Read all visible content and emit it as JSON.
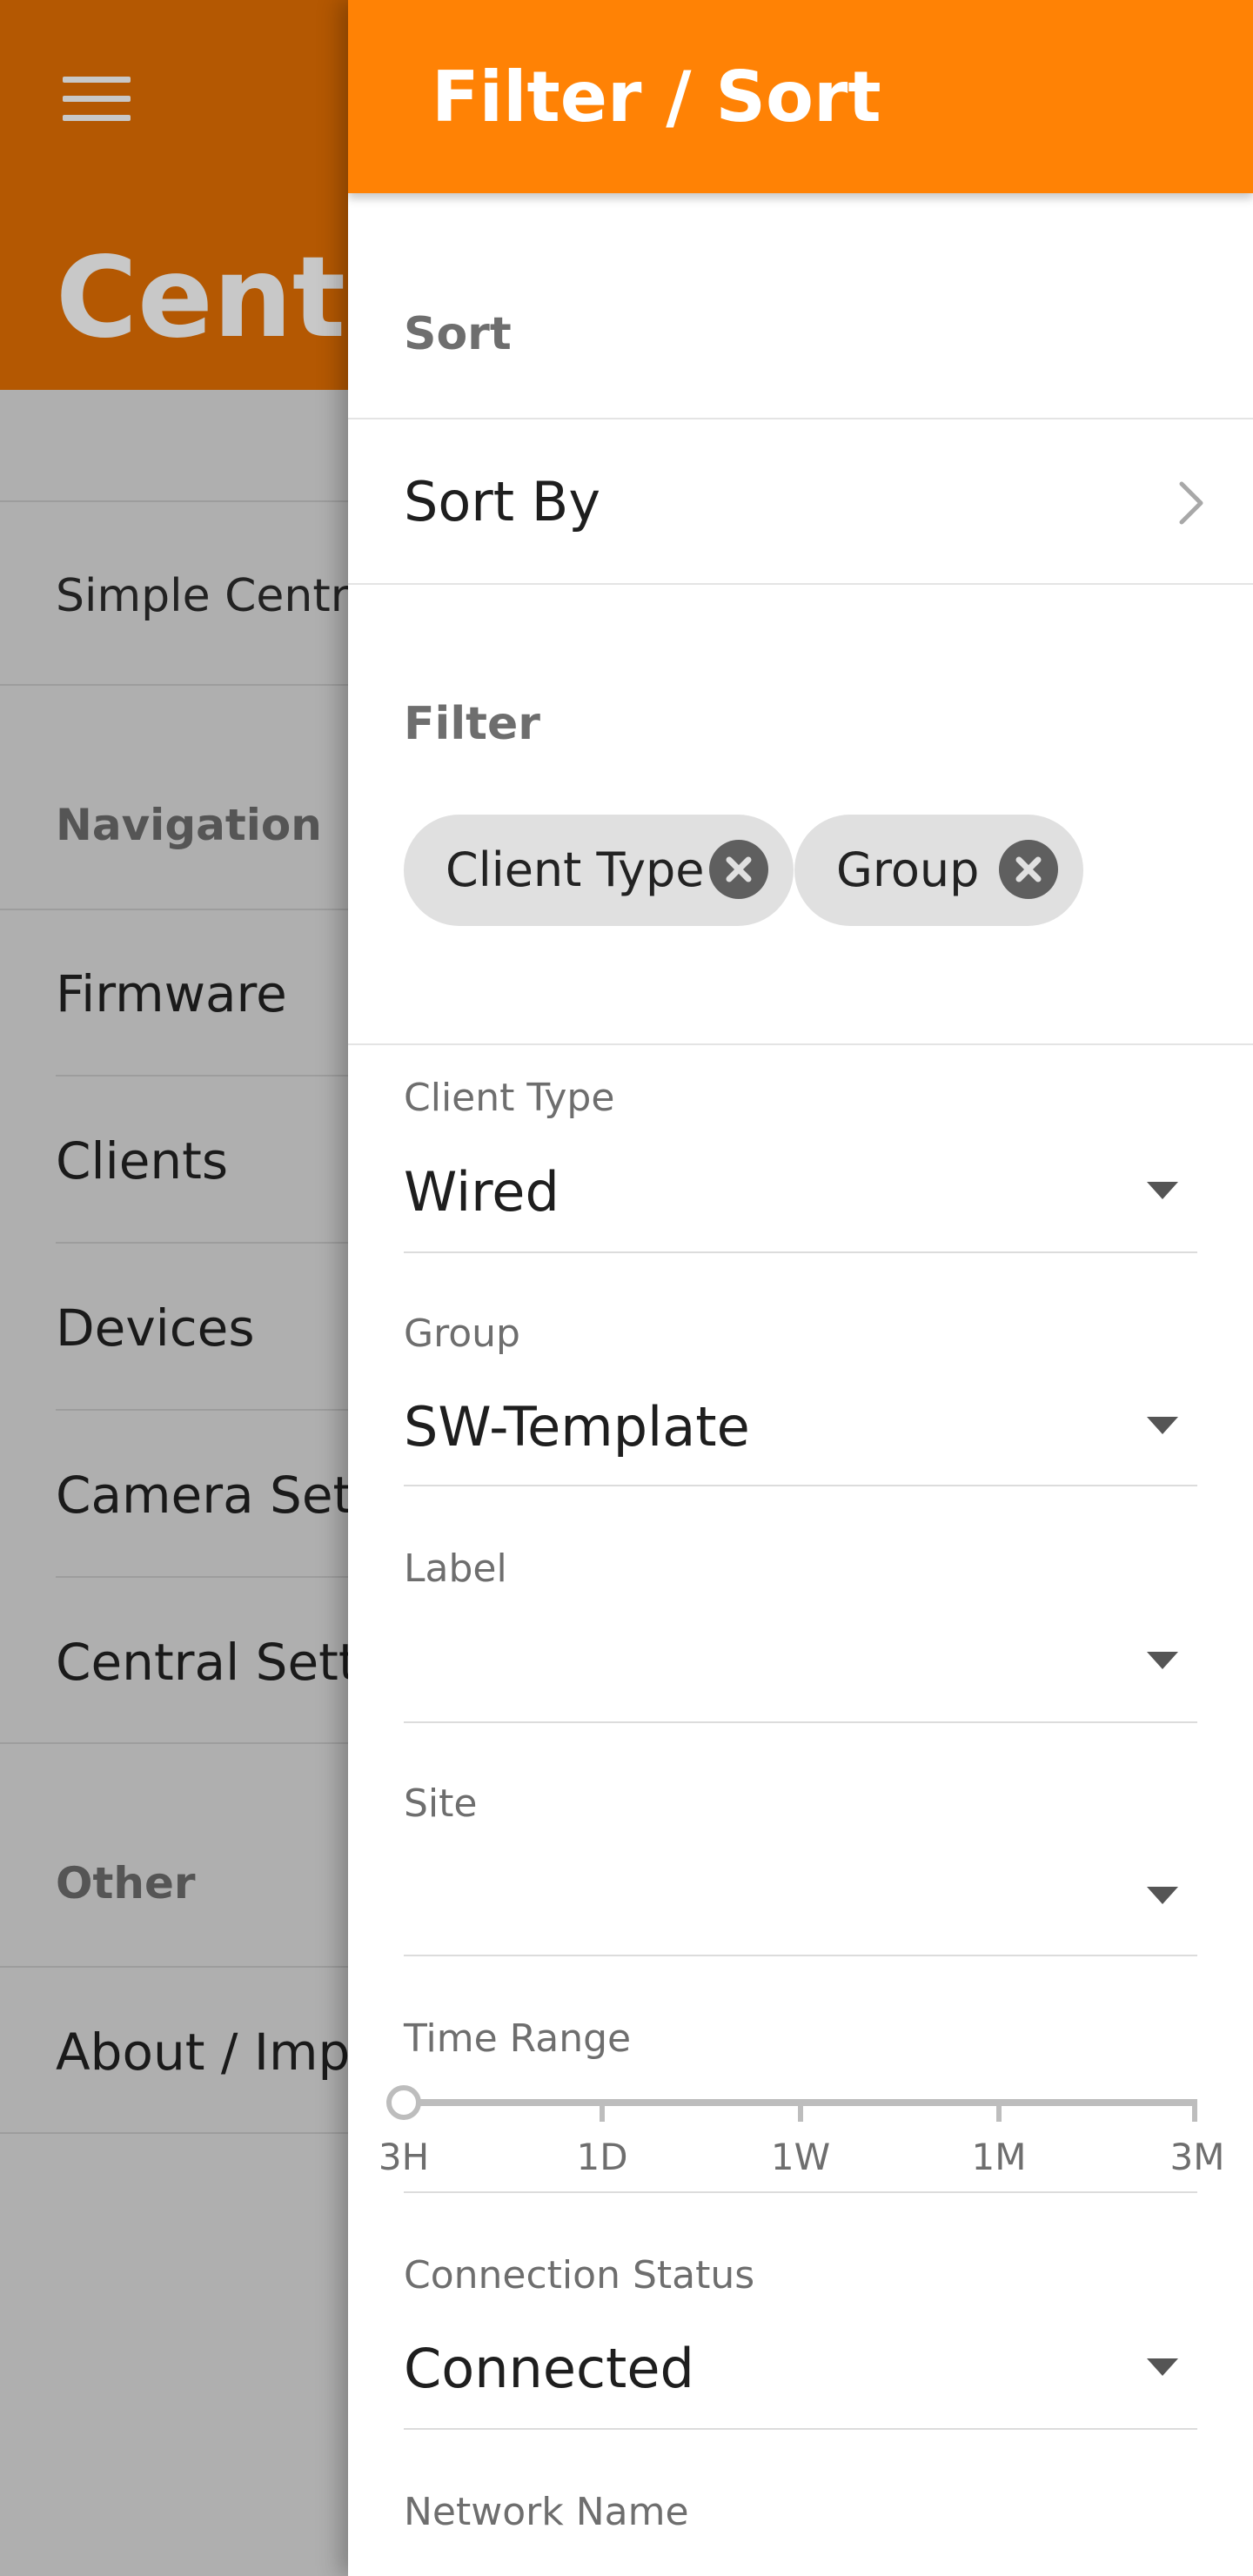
{
  "background": {
    "app_title": "Central",
    "items": {
      "simple_central": "Simple Central",
      "firmware": "Firmware",
      "clients": "Clients",
      "devices": "Devices",
      "camera_settings": "Camera Settings",
      "central_settings": "Central Settings",
      "about": "About / Imprint"
    },
    "sections": {
      "navigation": "Navigation",
      "other": "Other"
    }
  },
  "drawer": {
    "title": "Filter / Sort",
    "sort_section": "Sort",
    "sort_by_label": "Sort By",
    "filter_section": "Filter",
    "chips": [
      "Client Type",
      "Group"
    ],
    "fields": {
      "client_type": {
        "label": "Client Type",
        "value": "Wired"
      },
      "group": {
        "label": "Group",
        "value": "SW-Template"
      },
      "label": {
        "label": "Label",
        "value": ""
      },
      "site": {
        "label": "Site",
        "value": ""
      },
      "connection_status": {
        "label": "Connection Status",
        "value": "Connected"
      },
      "network_name": {
        "label": "Network Name"
      }
    },
    "time_range": {
      "label": "Time Range",
      "ticks": [
        "3H",
        "1D",
        "1W",
        "1M",
        "3M"
      ],
      "selected": "3H"
    }
  },
  "colors": {
    "accent": "#ff8205",
    "background_header": "#b45802",
    "scrim": "#afafaf"
  },
  "icons": {
    "menu": "hamburger-menu-icon",
    "chevron": "chevron-right-icon",
    "chip_close": "close-circle-icon",
    "dropdown": "dropdown-arrow-icon"
  }
}
